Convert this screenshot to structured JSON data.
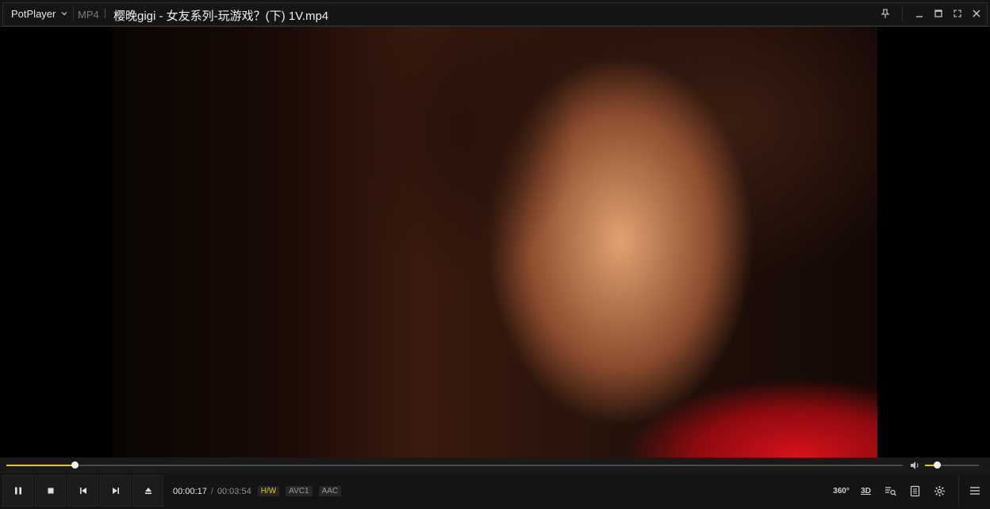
{
  "titlebar": {
    "app_name": "PotPlayer",
    "format": "MP4",
    "file_title": "樱晚gigi - 女友系列-玩游戏？(下) 1V.mp4"
  },
  "playback": {
    "current_time": "00:00:17",
    "separator": "/",
    "duration": "00:03:54",
    "progress_fraction": 0.076,
    "volume_fraction": 0.22
  },
  "tags": {
    "hw": "H/W",
    "video_codec": "AVC1",
    "audio_codec": "AAC"
  },
  "right_controls": {
    "vr_label": "360°",
    "stereo_label": "3D"
  },
  "colors": {
    "accent": "#e6c21a",
    "background": "#141414"
  }
}
